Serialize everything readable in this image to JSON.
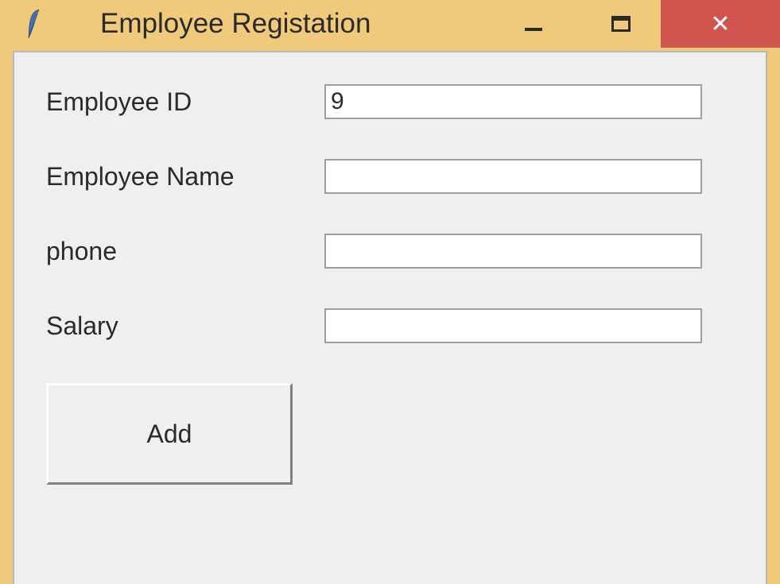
{
  "window": {
    "title": "Employee Registation"
  },
  "form": {
    "fields": [
      {
        "label": "Employee ID",
        "value": "9"
      },
      {
        "label": "Employee Name",
        "value": ""
      },
      {
        "label": "phone",
        "value": ""
      },
      {
        "label": "Salary",
        "value": ""
      }
    ],
    "add_button_label": "Add"
  }
}
